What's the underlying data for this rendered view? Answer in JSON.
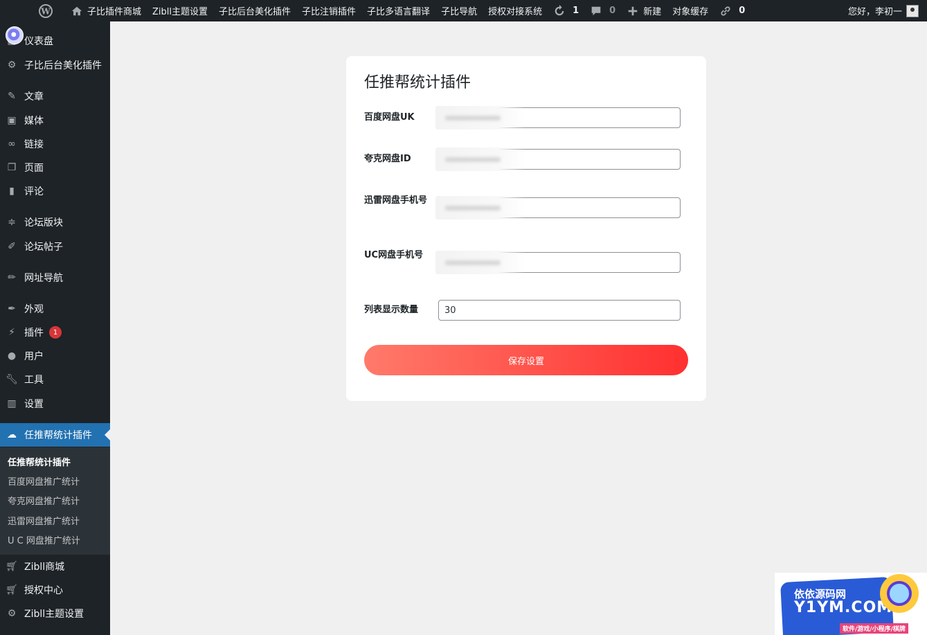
{
  "admin_bar": {
    "items": [
      {
        "label": "子比插件商城",
        "icon": "home-icon"
      },
      {
        "label": "Zibll主题设置"
      },
      {
        "label": "子比后台美化插件"
      },
      {
        "label": "子比注销插件"
      },
      {
        "label": "子比多语言翻译"
      },
      {
        "label": "子比导航"
      },
      {
        "label": "授权对接系统"
      }
    ],
    "updates_count": "1",
    "comments_count": "0",
    "new_label": "新建",
    "cache_label": "对象缓存",
    "links_count": "0",
    "greeting": "您好，李初一"
  },
  "sidebar": {
    "items": [
      {
        "label": "仪表盘",
        "icon": "dashboard-icon"
      },
      {
        "label": "子比后台美化插件",
        "icon": "gear-icon"
      },
      {
        "label": "文章",
        "icon": "pin-icon"
      },
      {
        "label": "媒体",
        "icon": "media-icon"
      },
      {
        "label": "链接",
        "icon": "link-icon"
      },
      {
        "label": "页面",
        "icon": "page-icon"
      },
      {
        "label": "评论",
        "icon": "comment-icon"
      },
      {
        "label": "论坛版块",
        "icon": "forum-icon"
      },
      {
        "label": "论坛帖子",
        "icon": "post-icon"
      },
      {
        "label": "网址导航",
        "icon": "brush-icon"
      },
      {
        "label": "外观",
        "icon": "appearance-icon"
      },
      {
        "label": "插件",
        "icon": "plugin-icon",
        "badge": "1"
      },
      {
        "label": "用户",
        "icon": "user-icon"
      },
      {
        "label": "工具",
        "icon": "wrench-icon"
      },
      {
        "label": "设置",
        "icon": "settings-icon"
      },
      {
        "label": "任推帮统计插件",
        "icon": "cloud-icon",
        "current": true
      },
      {
        "label": "Zibll商城",
        "icon": "cart-icon"
      },
      {
        "label": "授权中心",
        "icon": "cart-icon"
      },
      {
        "label": "Zibll主题设置",
        "icon": "gear-icon"
      }
    ],
    "submenu": [
      {
        "label": "任推帮统计插件",
        "active": true
      },
      {
        "label": "百度网盘推广统计"
      },
      {
        "label": "夸克网盘推广统计"
      },
      {
        "label": "迅雷网盘推广统计"
      },
      {
        "label": "U C 网盘推广统计"
      }
    ]
  },
  "form": {
    "title": "任推帮统计插件",
    "fields": [
      {
        "label": "百度网盘UK",
        "value": ""
      },
      {
        "label": "夸克网盘ID",
        "value": ""
      },
      {
        "label": "迅雷网盘手机号",
        "value": ""
      },
      {
        "label": "UC网盘手机号",
        "value": ""
      },
      {
        "label": "列表显示数量",
        "value": "30"
      }
    ],
    "save_label": "保存设置"
  },
  "watermark": {
    "line1": "依依源码网",
    "line2": "Y1YM.COM",
    "line3": "软件/游戏/小程序/棋牌"
  },
  "colors": {
    "admin_bg": "#1d2327",
    "current_menu": "#2271b1",
    "button_start": "#ff7a6a",
    "button_end": "#ff3030"
  }
}
